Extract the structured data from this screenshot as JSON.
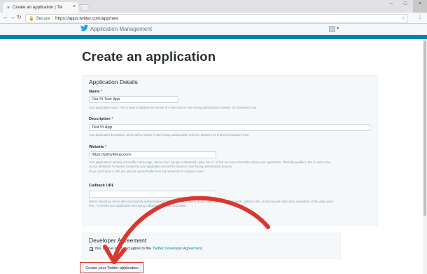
{
  "browser": {
    "tab_title": "Create an application | Tw",
    "secure_label": "Secure",
    "url": "https://apps.twitter.com/app/new"
  },
  "app_header": {
    "title": "Application Management"
  },
  "page": {
    "title": "Create an application"
  },
  "details": {
    "section_title": "Application Details",
    "name": {
      "label": "Name",
      "value": "Our Pi Test App",
      "help": "Your application name. This is used to attribute the source of a tweet and in user-facing authorization screens. 32 characters max."
    },
    "description": {
      "label": "Description",
      "value": "Test Pi App",
      "help": "Your application description, which will be shown in user-facing authorization screens. Between 10 and 200 characters max."
    },
    "website": {
      "label": "Website",
      "value": "https://pimylifeup.com",
      "help_lines": [
        "Your application's publicly accessible home page, where users can go to download, make use of, or find out more information about your application. This fully-qualified URL is used in the",
        "source attribution for tweets created by your application and will be shown in user-facing authorization screens.",
        "(If you don't have a URL yet, just put a placeholder here but remember to change it later.)"
      ]
    },
    "callback": {
      "label": "Callback URL",
      "value": "",
      "help_lines": [
        "Where should we return after successfully authenticating? OAuth 1.0a applications should explicitly specify their oauth_callback URL on the request token step, regardless of the value given",
        "here. To restrict your application from using callbacks, leave this field blank."
      ]
    }
  },
  "agreement": {
    "section_title": "Developer Agreement",
    "text_prefix": "Yes, I have read and agree to the",
    "link_text": "Twitter Developer Agreement",
    "text_suffix": ".",
    "checked": true
  },
  "submit_label": "Create your Twitter application",
  "colors": {
    "twitter_blue": "#1da1f2",
    "bar_blue": "#0084b4",
    "annotation_red": "#d9382e"
  }
}
